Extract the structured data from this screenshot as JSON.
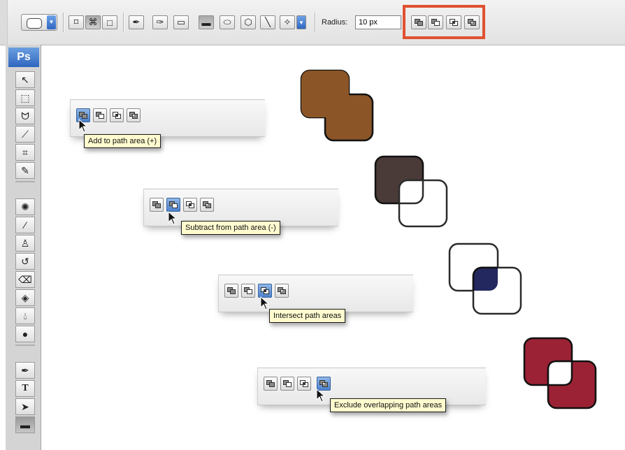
{
  "options_bar": {
    "radius_label": "Radius:",
    "radius_value": "10 px",
    "highlight_color": "#e05131"
  },
  "toolbox": {
    "logo": "Ps",
    "tools": [
      "move-tool",
      "marquee-tool",
      "lasso-tool",
      "magic-wand-tool",
      "crop-tool",
      "slice-tool",
      "healing-tool",
      "brush-tool",
      "stamp-tool",
      "history-brush-tool",
      "eraser-tool",
      "paint-bucket-tool",
      "blur-tool",
      "dodge-tool",
      "pen-tool",
      "type-tool",
      "path-selection-tool",
      "shape-tool"
    ]
  },
  "examples": [
    {
      "tooltip": "Add to path area (+)",
      "mode": "add",
      "fill_color": "#8b5527"
    },
    {
      "tooltip": "Subtract from path area (-)",
      "mode": "subtract",
      "fill_color": "#4a3b38"
    },
    {
      "tooltip": "Intersect path areas",
      "mode": "intersect",
      "fill_color": "#23285f"
    },
    {
      "tooltip": "Exclude overlapping path areas",
      "mode": "exclude",
      "fill_color": "#9b2234"
    }
  ]
}
